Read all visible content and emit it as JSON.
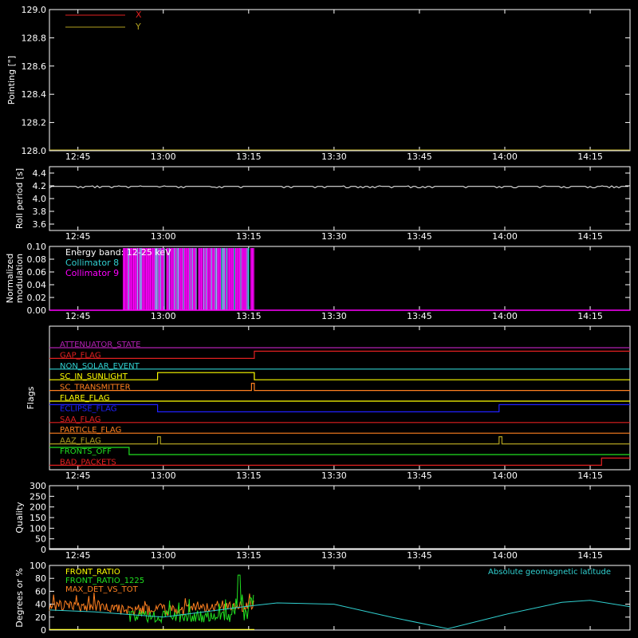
{
  "colors": {
    "background": "#000000",
    "axes": "#ffffff",
    "red": "#e02020",
    "olive": "#b0a020",
    "white": "#ffffff",
    "cyan": "#30d0d0",
    "magenta": "#ff00ff",
    "orange": "#ff8020",
    "yellow": "#ffff00",
    "blue": "#2020ff",
    "green": "#20e020",
    "purple": "#b020b0"
  },
  "time_ticks": [
    "12:45",
    "13:00",
    "13:15",
    "13:30",
    "13:45",
    "14:00",
    "14:15"
  ],
  "chart_data": [
    {
      "id": "pointing",
      "type": "line",
      "ylabel": "Pointing [\"]",
      "yticks": [
        "128.0",
        "128.2",
        "128.4",
        "128.6",
        "128.8",
        "129.0"
      ],
      "ylim": [
        128.0,
        129.0
      ],
      "xlim": [
        "12:40",
        "14:22"
      ],
      "legend": "top-left",
      "series": [
        {
          "name": "X",
          "color": "red",
          "values": []
        },
        {
          "name": "Y",
          "color": "olive",
          "values": []
        }
      ]
    },
    {
      "id": "roll",
      "type": "line",
      "ylabel": "Roll period [s]",
      "yticks": [
        "3.6",
        "3.8",
        "4.0",
        "4.2",
        "4.4"
      ],
      "ylim": [
        3.5,
        4.5
      ],
      "series": [
        {
          "color": "white",
          "approx_value": 4.19,
          "x": [
            "12:40",
            "14:22"
          ]
        }
      ]
    },
    {
      "id": "modulation",
      "type": "line",
      "ylabel": "Normalized modulation",
      "yticks": [
        "0.00",
        "0.02",
        "0.04",
        "0.06",
        "0.08",
        "0.10"
      ],
      "ylim": [
        0.0,
        0.1
      ],
      "annotation": "Energy band: 12-25 keV",
      "series": [
        {
          "name": "Collimator 8",
          "color": "cyan"
        },
        {
          "name": "Collimator 9",
          "color": "magenta"
        }
      ],
      "active_interval": [
        "12:53",
        "13:16"
      ]
    },
    {
      "id": "flags",
      "type": "line",
      "ylabel": "Flags",
      "flags": [
        {
          "name": "ATTENUATOR_STATE",
          "color": "purple",
          "transitions": [],
          "initial": 0
        },
        {
          "name": "GAP_FLAG",
          "color": "red",
          "transitions": [
            "13:16"
          ],
          "initial": 0
        },
        {
          "name": "NON_SOLAR_EVENT",
          "color": "cyan",
          "transitions": [],
          "initial": 0
        },
        {
          "name": "SC_IN_SUNLIGHT",
          "color": "yellow",
          "transitions": [
            "12:59",
            "13:16"
          ],
          "initial": 0
        },
        {
          "name": "SC_TRANSMITTER",
          "color": "orange",
          "transitions": [
            "13:15.5",
            "13:16"
          ],
          "initial": 0
        },
        {
          "name": "FLARE_FLAG",
          "color": "yellow",
          "transitions": [],
          "initial": 0
        },
        {
          "name": "ECLIPSE_FLAG",
          "color": "blue",
          "transitions": [
            "12:59",
            "13:59"
          ],
          "initial": 1
        },
        {
          "name": "SAA_FLAG",
          "color": "red",
          "transitions": [],
          "initial": 0
        },
        {
          "name": "PARTICLE_FLAG",
          "color": "orange",
          "transitions": [],
          "initial": 0
        },
        {
          "name": "AAZ_FLAG",
          "color": "olive",
          "transitions": [
            "12:59",
            "12:59.5",
            "13:59",
            "13:59.5"
          ],
          "initial": 0
        },
        {
          "name": "FRONTS_OFF",
          "color": "green",
          "transitions": [
            "12:54"
          ],
          "initial": 1
        },
        {
          "name": "BAD_PACKETS",
          "color": "red",
          "transitions": [
            "14:17"
          ],
          "initial": 0
        }
      ]
    },
    {
      "id": "quality",
      "type": "line",
      "ylabel": "Quality",
      "yticks": [
        "0",
        "50",
        "100",
        "150",
        "200",
        "250",
        "300"
      ],
      "ylim": [
        0,
        300
      ],
      "series": [
        {
          "color": "white",
          "values": []
        }
      ]
    },
    {
      "id": "ratios",
      "type": "line",
      "ylabel": "Degrees or %",
      "yticks": [
        "0",
        "20",
        "40",
        "60",
        "80",
        "100"
      ],
      "ylim": [
        0,
        100
      ],
      "series": [
        {
          "name": "FRONT_RATIO",
          "color": "yellow"
        },
        {
          "name": "FRONT_RATIO_1225",
          "color": "green"
        },
        {
          "name": "MAX_DET_VS_TOT",
          "color": "orange"
        },
        {
          "name": "Absolute geomagnetic latitude",
          "color": "cyan",
          "x": [
            "12:40",
            "12:48",
            "13:00",
            "13:15",
            "13:20",
            "13:30",
            "13:40",
            "13:50",
            "14:00",
            "14:10",
            "14:15",
            "14:22"
          ],
          "values": [
            31,
            28,
            20,
            37,
            42,
            40,
            20,
            2,
            24,
            43,
            46,
            36
          ]
        }
      ]
    }
  ]
}
